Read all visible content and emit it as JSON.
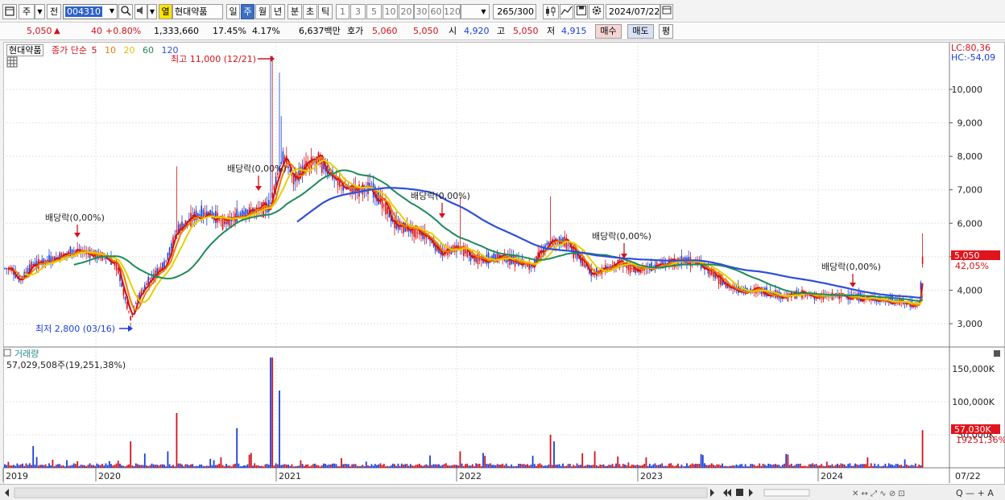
{
  "toolbar": {
    "period_type": "주",
    "code_prefix_label": "전",
    "stock_code": "004310",
    "mode_label": "열",
    "stock_name": "현대약품",
    "intervals": [
      "일",
      "주",
      "월",
      "년",
      "분",
      "초",
      "틱"
    ],
    "selected_interval": "주",
    "minute_options": [
      "1",
      "3",
      "5",
      "10",
      "20",
      "30",
      "60",
      "120"
    ],
    "count_display": "265",
    "count_max": "/300",
    "date": "2024/07/22"
  },
  "quote": {
    "price": "5,050",
    "change": "40",
    "change_pct": "+0.80%",
    "volume": "1,333,660",
    "turnover_pct": "17.45%",
    "other_pct": "4.17%",
    "trade_value": "6,637백만",
    "ask_label": "호가",
    "ask": "5,060",
    "bid": "5,050",
    "open_label": "시",
    "open": "4,920",
    "high_label": "고",
    "high": "5,050",
    "low_label": "저",
    "low": "4,915",
    "buy_label": "매수",
    "sell_label": "매도",
    "avg_label": "평"
  },
  "price_panel": {
    "stock_label": "현대약품",
    "ma_label_prefix": "종가 단순",
    "ma_periods": [
      "5",
      "10",
      "20",
      "60",
      "120"
    ],
    "ma_colors": [
      "#d3121a",
      "#f07c00",
      "#e6d000",
      "#1f8a5a",
      "#2e4fd8"
    ],
    "lc_text": "LC:80,36",
    "hc_text": "HC:-54,09",
    "max_label": "최고 11,000 (12/21)",
    "min_label": "최저 2,800 (03/16)",
    "dividend_label": "배당락(0,00%)",
    "current_price_badge": "5,050",
    "current_pct_label": "42,05%",
    "y_ticks": [
      "10,000",
      "9,000",
      "8,000",
      "7,000",
      "6,000",
      "5,000",
      "4,000",
      "3,000"
    ]
  },
  "volume_panel": {
    "title": "거래량",
    "info": "57,029,508주(19,251,38%)",
    "y_ticks": [
      "150,000K",
      "100,000K",
      "50,000K"
    ],
    "current_badge": "57,030K",
    "current_pct": "19251,36%"
  },
  "x_axis": {
    "year_labels": [
      "2019",
      "2020",
      "2021",
      "2022",
      "2023",
      "2024"
    ],
    "last_date": "07/22"
  },
  "colors": {
    "up": "#d3121a",
    "down": "#1a3fd8",
    "badge": "#e0141c",
    "selected": "#3c6fc4"
  }
}
